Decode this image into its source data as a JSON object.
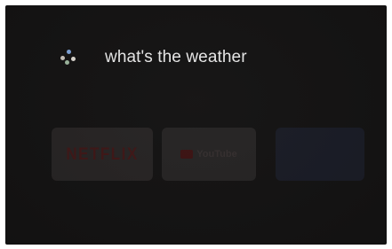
{
  "assistant": {
    "query": "what's the weather",
    "icon": "google-assistant-icon",
    "dot_colors": [
      "#7fa3d8",
      "#c9c3bb",
      "#dedad3",
      "#9fb8a0"
    ]
  },
  "rows": {
    "apps_title": "",
    "apps": [
      {
        "name": "NETFLIX",
        "icon": "netflix-logo",
        "caption": ""
      },
      {
        "name": "YouTube",
        "icon": "youtube-logo"
      },
      {
        "name": "",
        "icon": "blue-app-tile"
      }
    ],
    "second_title": ""
  },
  "colors": {
    "background": "#141313",
    "query_text": "#e9e9e9"
  }
}
